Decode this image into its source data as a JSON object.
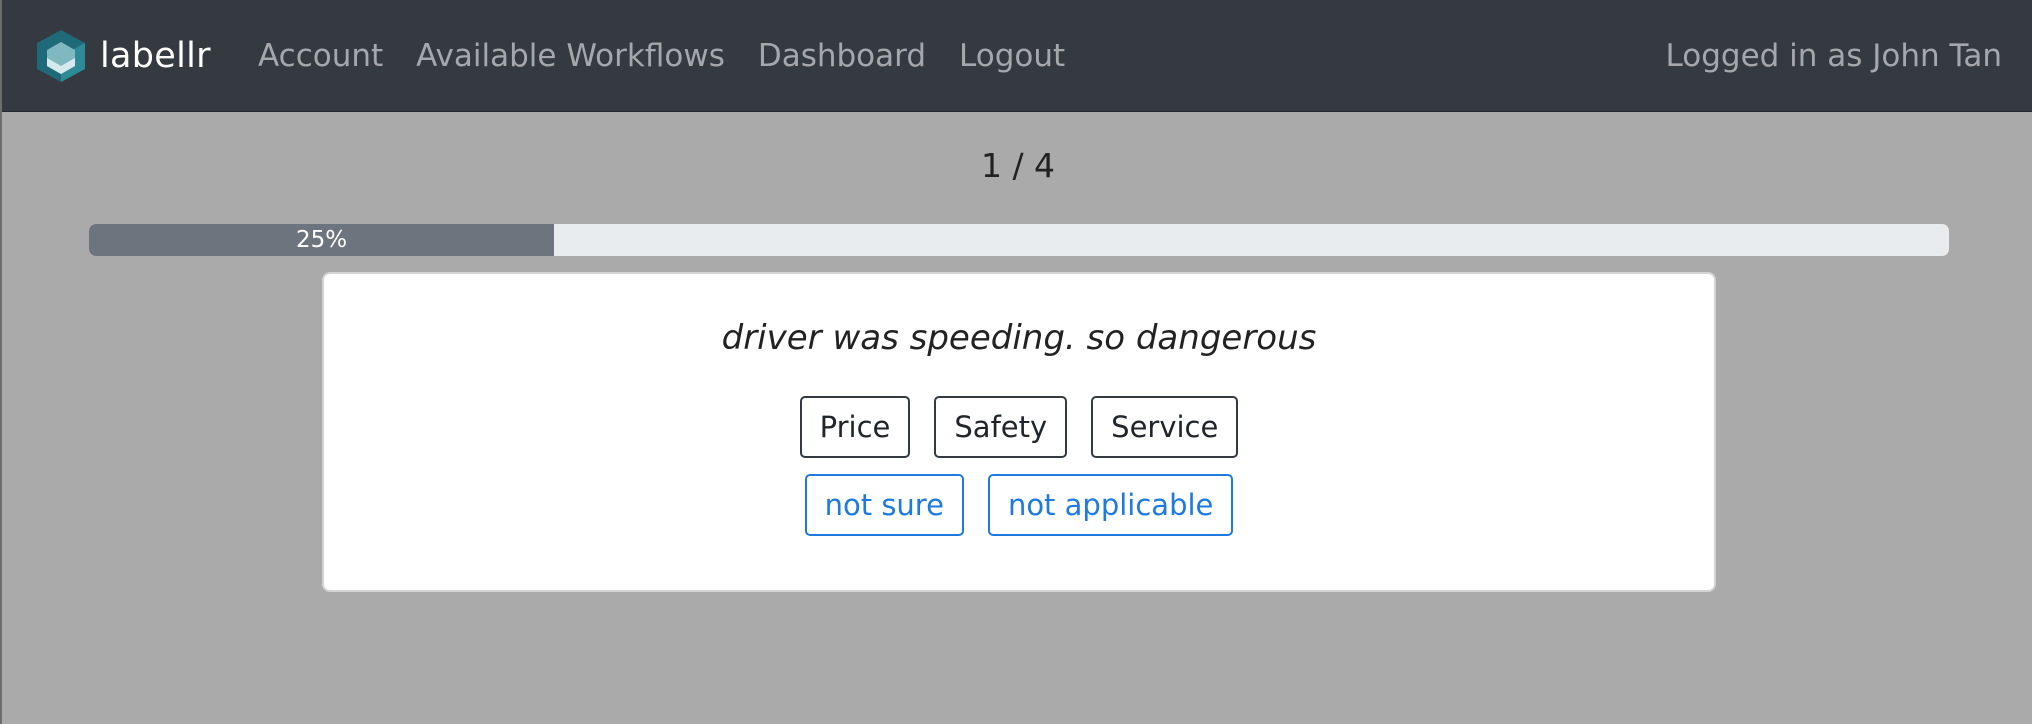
{
  "navbar": {
    "brand": "labellr",
    "links": [
      "Account",
      "Available Workflows",
      "Dashboard",
      "Logout"
    ],
    "user_text": "Logged in as John Tan"
  },
  "progress": {
    "counter": "1 / 4",
    "label": "25%",
    "fraction": 0.25
  },
  "task": {
    "sentence": "driver was speeding. so dangerous",
    "labels": [
      "Price",
      "Safety",
      "Service"
    ],
    "extra_options": [
      "not sure",
      "not applicable"
    ]
  },
  "colors": {
    "navbar_bg": "#343a40",
    "page_bg": "#aaaaaa",
    "progress_fill": "#6c757d",
    "accent_blue": "#1f7ae0"
  }
}
